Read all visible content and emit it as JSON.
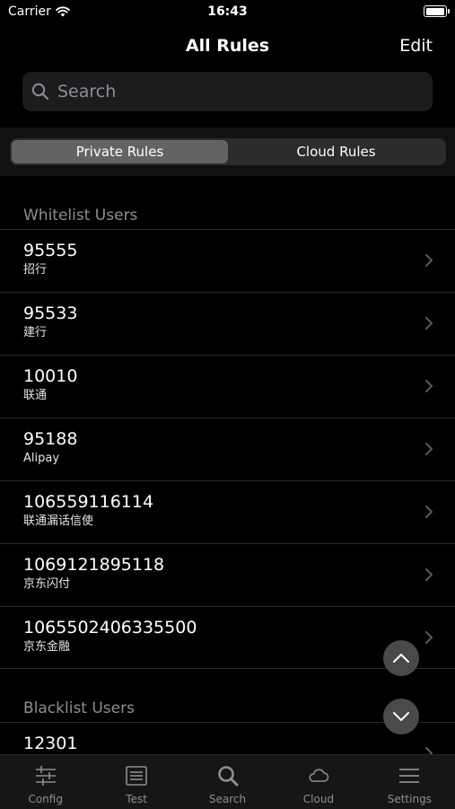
{
  "status_bar": {
    "carrier": "Carrier",
    "time": "16:43"
  },
  "nav": {
    "title": "All Rules",
    "edit_label": "Edit"
  },
  "search": {
    "placeholder": "Search"
  },
  "segments": [
    {
      "label": "Private Rules",
      "selected": true
    },
    {
      "label": "Cloud Rules",
      "selected": false
    }
  ],
  "sections": [
    {
      "header": "Whitelist Users",
      "rows": [
        {
          "title": "95555",
          "subtitle": "招行"
        },
        {
          "title": "95533",
          "subtitle": "建行"
        },
        {
          "title": "10010",
          "subtitle": "联通"
        },
        {
          "title": "95188",
          "subtitle": "Alipay"
        },
        {
          "title": "106559116114",
          "subtitle": "联通漏话信使"
        },
        {
          "title": "1069121895118",
          "subtitle": "京东闪付"
        },
        {
          "title": "1065502406335500",
          "subtitle": "京东金融"
        }
      ]
    },
    {
      "header": "Blacklist Users",
      "rows": [
        {
          "title": "12301",
          "subtitle": ""
        }
      ]
    }
  ],
  "tabs": [
    {
      "label": "Config",
      "icon": "sliders-icon"
    },
    {
      "label": "Test",
      "icon": "list-box-icon"
    },
    {
      "label": "Search",
      "icon": "search-icon"
    },
    {
      "label": "Cloud",
      "icon": "cloud-icon"
    },
    {
      "label": "Settings",
      "icon": "menu-icon"
    }
  ],
  "colors": {
    "background": "#000000",
    "secondary_text": "#8e8e93",
    "segment_selected": "#636366"
  }
}
